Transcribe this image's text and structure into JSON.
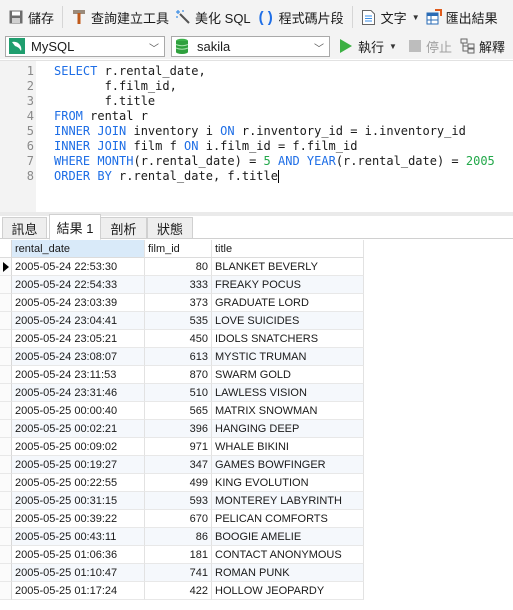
{
  "toolbar": {
    "save_label": "儲存",
    "query_builder_label": "查詢建立工具",
    "beautify_label": "美化 SQL",
    "snippet_label": "程式碼片段",
    "text_label": "文字",
    "export_label": "匯出結果"
  },
  "connection": {
    "selected": "MySQL",
    "database": "sakila",
    "run_label": "執行",
    "stop_label": "停止",
    "explain_label": "解釋"
  },
  "editor": {
    "lines": [
      {
        "n": "1",
        "tokens": [
          {
            "t": "SELECT",
            "k": "kw"
          },
          {
            "t": " r.rental_date,",
            "k": ""
          }
        ]
      },
      {
        "n": "2",
        "tokens": [
          {
            "t": "       f.film_id,",
            "k": ""
          }
        ]
      },
      {
        "n": "3",
        "tokens": [
          {
            "t": "       f.title",
            "k": ""
          }
        ]
      },
      {
        "n": "4",
        "tokens": [
          {
            "t": "FROM",
            "k": "kw"
          },
          {
            "t": " rental r",
            "k": ""
          }
        ]
      },
      {
        "n": "5",
        "tokens": [
          {
            "t": "INNER JOIN",
            "k": "kw"
          },
          {
            "t": " inventory i ",
            "k": ""
          },
          {
            "t": "ON",
            "k": "kw"
          },
          {
            "t": " r.inventory_id = i.inventory_id",
            "k": ""
          }
        ]
      },
      {
        "n": "6",
        "tokens": [
          {
            "t": "INNER JOIN",
            "k": "kw"
          },
          {
            "t": " film f ",
            "k": ""
          },
          {
            "t": "ON",
            "k": "kw"
          },
          {
            "t": " i.film_id = f.film_id",
            "k": ""
          }
        ]
      },
      {
        "n": "7",
        "tokens": [
          {
            "t": "WHERE",
            "k": "kw"
          },
          {
            "t": " ",
            "k": ""
          },
          {
            "t": "MONTH",
            "k": "kw"
          },
          {
            "t": "(r.rental_date) = ",
            "k": ""
          },
          {
            "t": "5",
            "k": "num"
          },
          {
            "t": " ",
            "k": ""
          },
          {
            "t": "AND",
            "k": "kw"
          },
          {
            "t": " ",
            "k": ""
          },
          {
            "t": "YEAR",
            "k": "kw"
          },
          {
            "t": "(r.rental_date) = ",
            "k": ""
          },
          {
            "t": "2005",
            "k": "num"
          }
        ]
      },
      {
        "n": "8",
        "tokens": [
          {
            "t": "ORDER BY",
            "k": "kw"
          },
          {
            "t": " r.rental_date, f.title",
            "k": ""
          }
        ],
        "caret": true
      }
    ]
  },
  "result_tabs": [
    {
      "label": "訊息",
      "active": false
    },
    {
      "label": "結果 1",
      "active": true
    },
    {
      "label": "剖析",
      "active": false
    },
    {
      "label": "狀態",
      "active": false
    }
  ],
  "grid": {
    "columns": [
      "rental_date",
      "film_id",
      "title"
    ],
    "rows": [
      [
        "2005-05-24 22:53:30",
        "80",
        "BLANKET BEVERLY"
      ],
      [
        "2005-05-24 22:54:33",
        "333",
        "FREAKY POCUS"
      ],
      [
        "2005-05-24 23:03:39",
        "373",
        "GRADUATE LORD"
      ],
      [
        "2005-05-24 23:04:41",
        "535",
        "LOVE SUICIDES"
      ],
      [
        "2005-05-24 23:05:21",
        "450",
        "IDOLS SNATCHERS"
      ],
      [
        "2005-05-24 23:08:07",
        "613",
        "MYSTIC TRUMAN"
      ],
      [
        "2005-05-24 23:11:53",
        "870",
        "SWARM GOLD"
      ],
      [
        "2005-05-24 23:31:46",
        "510",
        "LAWLESS VISION"
      ],
      [
        "2005-05-25 00:00:40",
        "565",
        "MATRIX SNOWMAN"
      ],
      [
        "2005-05-25 00:02:21",
        "396",
        "HANGING DEEP"
      ],
      [
        "2005-05-25 00:09:02",
        "971",
        "WHALE BIKINI"
      ],
      [
        "2005-05-25 00:19:27",
        "347",
        "GAMES BOWFINGER"
      ],
      [
        "2005-05-25 00:22:55",
        "499",
        "KING EVOLUTION"
      ],
      [
        "2005-05-25 00:31:15",
        "593",
        "MONTEREY LABYRINTH"
      ],
      [
        "2005-05-25 00:39:22",
        "670",
        "PELICAN COMFORTS"
      ],
      [
        "2005-05-25 00:43:11",
        "86",
        "BOOGIE AMELIE"
      ],
      [
        "2005-05-25 01:06:36",
        "181",
        "CONTACT ANONYMOUS"
      ],
      [
        "2005-05-25 01:10:47",
        "741",
        "ROMAN PUNK"
      ],
      [
        "2005-05-25 01:17:24",
        "422",
        "HOLLOW JEOPARDY"
      ]
    ],
    "current_row": 0
  },
  "colors": {
    "keyword": "#1e6ee6",
    "number": "#22a84a",
    "run_green": "#3cb043",
    "header_selected": "#d9eaf9"
  }
}
